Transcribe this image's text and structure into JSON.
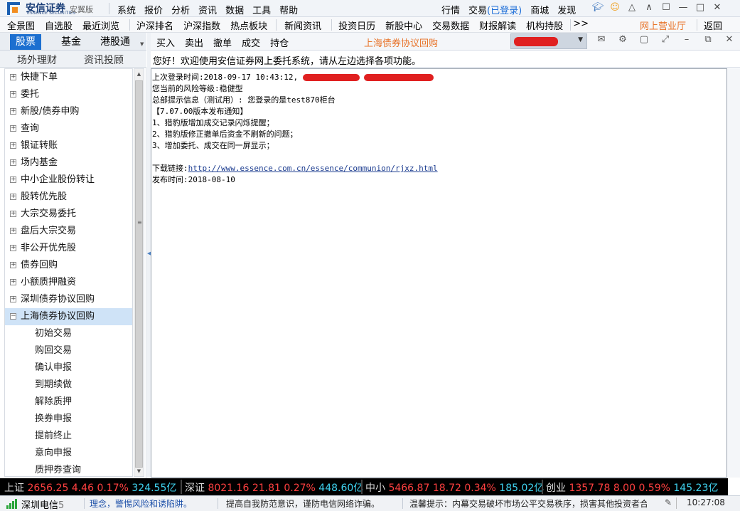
{
  "app": {
    "brand": "安信证券",
    "brand_en": "ESSENCE SECURITIES",
    "edition": "安翼版"
  },
  "menu": [
    "系统",
    "报价",
    "分析",
    "资讯",
    "数据",
    "工具",
    "帮助"
  ],
  "right_menu": {
    "quote": "行情",
    "trade": "交易",
    "login_status": "(已登录)",
    "mall": "商城",
    "discover": "发现"
  },
  "toolbar": {
    "items": [
      "全景图",
      "自选股",
      "最近浏览",
      "沪深排名",
      "沪深指数",
      "热点板块",
      "新闻资讯",
      "投资日历",
      "新股中心",
      "交易数据",
      "财报解读",
      "机构持股",
      ">>"
    ],
    "online_hall": "网上营业厅",
    "back": "返回"
  },
  "left_tabs": {
    "row1": [
      "股票",
      "基金",
      "港股通"
    ],
    "row2": [
      "场外理财",
      "资讯投顾"
    ]
  },
  "tree": {
    "nodes": [
      "快捷下单",
      "委托",
      "新股/债券申购",
      "查询",
      "银证转账",
      "场内基金",
      "中小企业股份转让",
      "股转优先股",
      "大宗交易委托",
      "盘后大宗交易",
      "非公开优先股",
      "债券回购",
      "小额质押融资",
      "深圳债券协议回购",
      "上海债券协议回购"
    ],
    "children": [
      "初始交易",
      "购回交易",
      "确认申报",
      "到期续做",
      "解除质押",
      "换券申报",
      "提前终止",
      "意向申报",
      "质押券查询"
    ]
  },
  "right_toolbar": {
    "actions": [
      "买入",
      "卖出",
      "撤单",
      "成交",
      "持仓"
    ],
    "panel_title": "上海债券协议回购"
  },
  "welcome": "您好！欢迎使用安信证券网上委托系统，请从左边选择各项功能。",
  "message": {
    "login_time": "上次登录时间:2018-09-17 10:43:12,",
    "risk_level": "您当前的风险等级:稳健型",
    "hq_tip": "总部提示信息（测试用）: 您登录的是test870柜台",
    "release_title": "【7.07.00版本发布通知】",
    "item1": "1、猎豹版增加成交记录闪烁提醒；",
    "item2": "2、猎豹版修正撤单后资金不刷新的问题；",
    "item3": "3、增加委托、成交在同一屏显示；",
    "download_label": "下载链接:",
    "download_url": "http://www.essence.com.cn/essence/communion/rjxz.html",
    "release_date": "发布时间:2018-08-10"
  },
  "ticker": [
    {
      "name": "上证",
      "value": "2656.25",
      "change": "4.46",
      "pct": "0.17%",
      "amount": "324.55亿"
    },
    {
      "name": "深证",
      "value": "8021.16",
      "change": "21.81",
      "pct": "0.27%",
      "amount": "448.60亿"
    },
    {
      "name": "中小",
      "value": "5466.87",
      "change": "18.72",
      "pct": "0.34%",
      "amount": "185.02亿"
    },
    {
      "name": "创业",
      "value": "1357.78",
      "change": "8.00",
      "pct": "0.59%",
      "amount": "145.23亿"
    }
  ],
  "status": {
    "telecom": "深圳电信",
    "telecom_num": "5",
    "scroll1": "理念，警惕风险和诱陷阱。",
    "scroll2": "提高自我防范意识，谨防电信网络诈骗。",
    "scroll3": "温馨提示：内幕交易破坏市场公平交易秩序，损害其他投资者合",
    "time": "10:27:08"
  },
  "colors": {
    "accent_blue": "#1c6fd0",
    "orange": "#e8742a",
    "price_up": "#ff4040",
    "amount_cyan": "#3fd3f0"
  }
}
